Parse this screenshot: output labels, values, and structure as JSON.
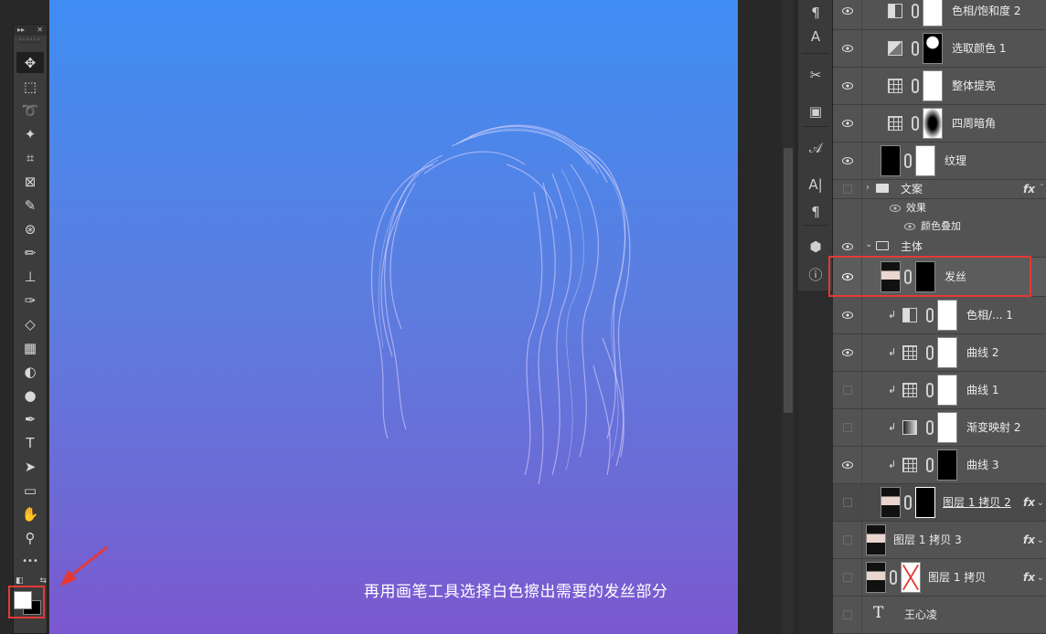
{
  "toolbar": {
    "header_left": "▸▸",
    "header_right": "✕",
    "tools": [
      {
        "name": "move-tool-icon",
        "glyph": "✥"
      },
      {
        "name": "marquee-tool-icon",
        "glyph": "⬚"
      },
      {
        "name": "lasso-tool-icon",
        "glyph": "➰"
      },
      {
        "name": "magic-wand-tool-icon",
        "glyph": "✦"
      },
      {
        "name": "crop-tool-icon",
        "glyph": "⌗"
      },
      {
        "name": "frame-tool-icon",
        "glyph": "⊠"
      },
      {
        "name": "eyedropper-tool-icon",
        "glyph": "✎"
      },
      {
        "name": "healing-brush-tool-icon",
        "glyph": "⊛"
      },
      {
        "name": "brush-tool-icon",
        "glyph": "✏"
      },
      {
        "name": "clone-stamp-tool-icon",
        "glyph": "⊥"
      },
      {
        "name": "history-brush-tool-icon",
        "glyph": "✑"
      },
      {
        "name": "eraser-tool-icon",
        "glyph": "◇"
      },
      {
        "name": "gradient-tool-icon",
        "glyph": "▦"
      },
      {
        "name": "blur-tool-icon",
        "glyph": "◐"
      },
      {
        "name": "dodge-tool-icon",
        "glyph": "●"
      },
      {
        "name": "pen-tool-icon",
        "glyph": "✒"
      },
      {
        "name": "type-tool-icon",
        "glyph": "T"
      },
      {
        "name": "path-selection-tool-icon",
        "glyph": "➤"
      },
      {
        "name": "rectangle-tool-icon",
        "glyph": "▭"
      },
      {
        "name": "hand-tool-icon",
        "glyph": "✋"
      },
      {
        "name": "zoom-tool-icon",
        "glyph": "⚲"
      },
      {
        "name": "more-tools-icon",
        "glyph": "•••"
      }
    ],
    "foreground_color": "#ffffff",
    "background_color": "#000000"
  },
  "canvas": {
    "caption": "再用画笔工具选择白色擦出需要的发丝部分",
    "gradient_top": "#3f8df3",
    "gradient_bottom": "#7b58cf"
  },
  "mini_panel": {
    "buttons": [
      {
        "name": "paragraph-styles-icon",
        "glyph": "¶"
      },
      {
        "name": "character-styles-icon",
        "glyph": "A"
      },
      {
        "name": "tool-presets-icon",
        "glyph": "✂"
      },
      {
        "name": "clone-source-icon",
        "glyph": "▣"
      },
      {
        "name": "glyphs-icon",
        "glyph": "𝒜"
      },
      {
        "name": "character-icon",
        "glyph": "A|"
      },
      {
        "name": "paragraph-icon",
        "glyph": "¶"
      },
      {
        "name": "3d-icon",
        "glyph": "⬢"
      },
      {
        "name": "info-icon",
        "glyph": "ⓘ"
      }
    ]
  },
  "layers": {
    "rows": [
      {
        "label": "色相/饱和度 2",
        "visible": true
      },
      {
        "label": "选取颜色 1",
        "visible": true
      },
      {
        "label": "整体提亮",
        "visible": true
      },
      {
        "label": "四周暗角",
        "visible": true
      },
      {
        "label": "纹理",
        "visible": true
      },
      {
        "label": "文案",
        "visible": false,
        "fx": "fx"
      },
      {
        "label": "效果"
      },
      {
        "label": "颜色叠加"
      },
      {
        "label": "主体",
        "visible": true
      },
      {
        "label": "发丝",
        "visible": true
      },
      {
        "label": "色相/... 1",
        "visible": true
      },
      {
        "label": "曲线 2",
        "visible": true
      },
      {
        "label": "曲线 1",
        "visible": false
      },
      {
        "label": "渐变映射 2",
        "visible": false
      },
      {
        "label": "曲线 3",
        "visible": true
      },
      {
        "label": "图层 1 拷贝 2",
        "visible": false,
        "fx": "fx"
      },
      {
        "label": "图层 1 拷贝 3",
        "visible": false,
        "fx": "fx"
      },
      {
        "label": "图层 1 拷贝",
        "visible": false,
        "fx": "fx"
      },
      {
        "label": "王心凌",
        "visible": false
      }
    ]
  },
  "colors": {
    "highlight": "#e53935",
    "panel_bg": "#535353"
  }
}
